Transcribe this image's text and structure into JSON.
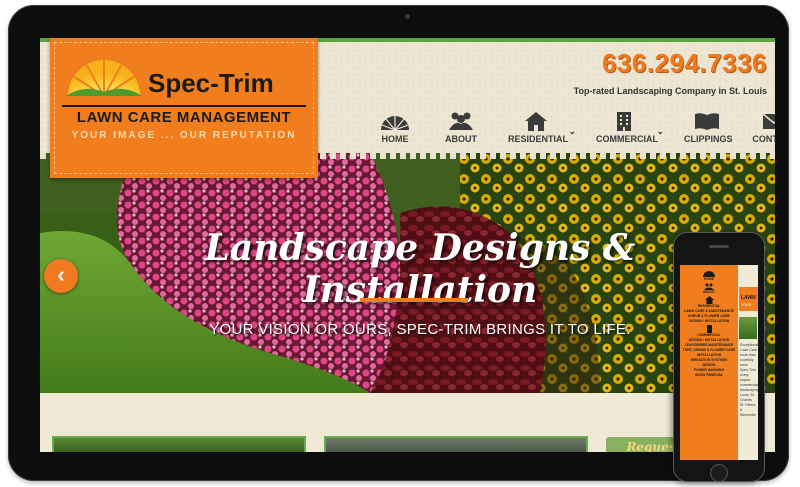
{
  "site": {
    "phone": "636.294.7336",
    "tagline": "Top-rated Landscaping Company in St. Louis"
  },
  "logo": {
    "brand": "Spec-Trim",
    "subtitle": "LAWN CARE MANAGEMENT",
    "motto": "YOUR IMAGE ... OUR REPUTATION"
  },
  "nav": {
    "items": [
      {
        "label": "HOME",
        "icon": "sun-icon"
      },
      {
        "label": "ABOUT",
        "icon": "people-icon"
      },
      {
        "label": "RESIDENTIAL",
        "icon": "house-icon"
      },
      {
        "label": "COMMERCIAL",
        "icon": "building-icon"
      },
      {
        "label": "CLIPPINGS",
        "icon": "book-icon"
      },
      {
        "label": "CONTACT",
        "icon": "envelope-icon"
      }
    ]
  },
  "hero": {
    "title": "Landscape Designs & Installation",
    "subtitle": "YOUR VISION OR OURS, SPEC-TRIM BRINGS IT TO LIFE.",
    "prev_label": "‹"
  },
  "below": {
    "button_label": "Reques"
  },
  "phone": {
    "menu": [
      "HOME",
      "ABOUT",
      "RESIDENTIAL",
      "LAWN CARE & MAINTENANCE",
      "SHRUB & FLOWER CARE",
      "DESIGN / INSTALLATION",
      "COMMERCIAL",
      "DESIGN / INSTALLATION",
      "LEAF/DEBRIS MAINTENANCE",
      "TREE, SHRUB & FLOWER CARE",
      "INSTALLATION",
      "IRRIGATION SYSTEMS",
      "DESIGN",
      "POWER WASHING",
      "SNOW REMOVAL"
    ],
    "side_logo": "LAWN",
    "side_motto": "YOUR",
    "side_text": "Exceptional Lawn Care more than a weekly mow. Spec-Trim every aspect commercial landscaping Louis, St. Charles St. Peters & Wentzville"
  },
  "colors": {
    "accent_orange": "#f07e1f",
    "accent_green": "#5da341",
    "header_bg": "#ece6d2"
  }
}
